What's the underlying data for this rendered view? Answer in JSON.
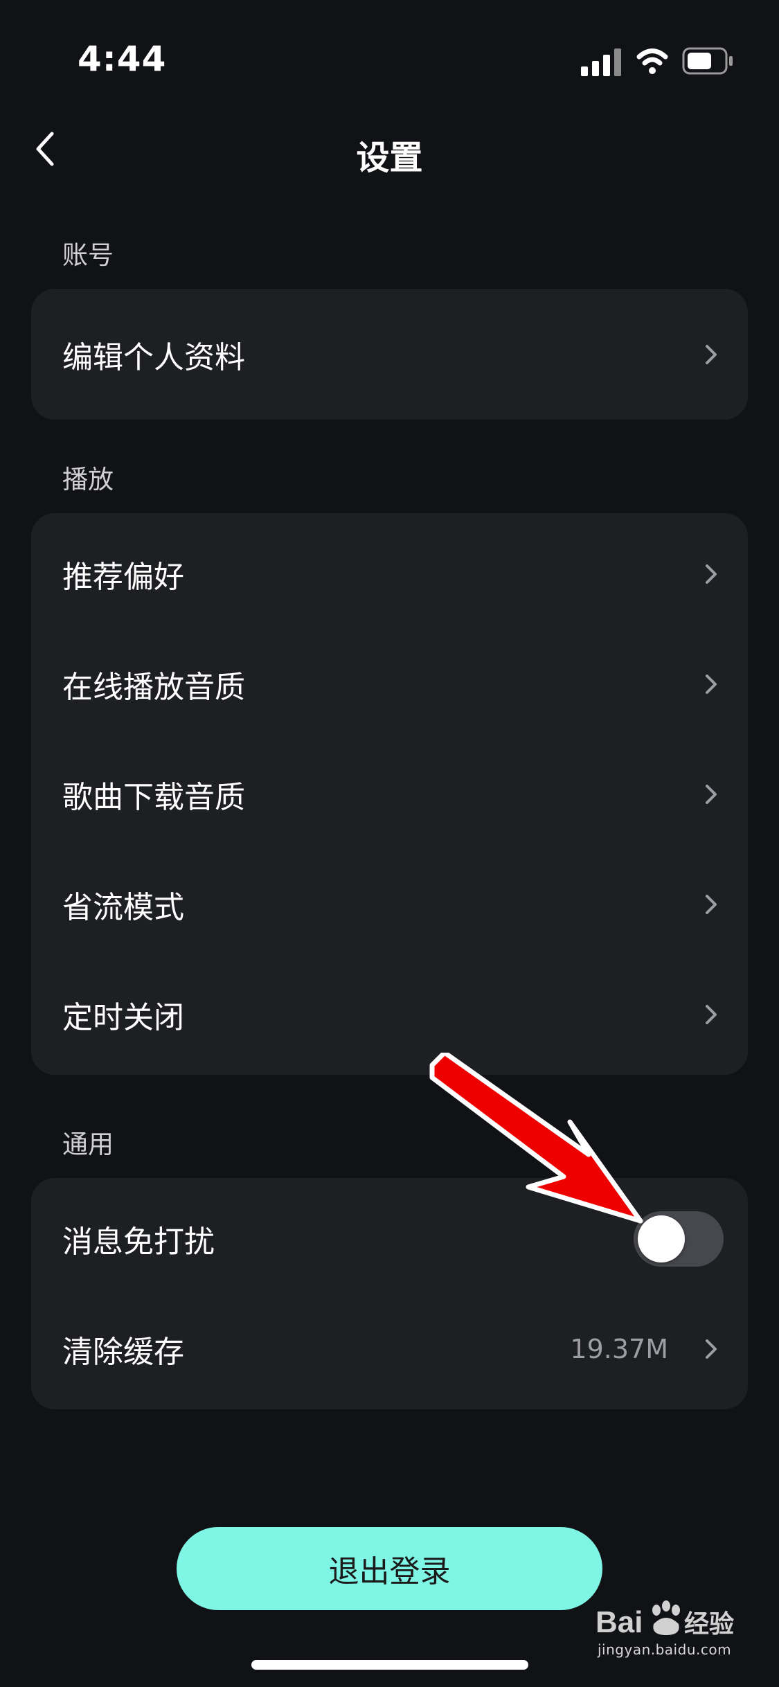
{
  "status_bar": {
    "time": "4:44",
    "icons": [
      "cellular-signal-icon",
      "wifi-icon",
      "battery-icon"
    ]
  },
  "nav": {
    "title": "设置",
    "back_icon": "chevron-left-icon"
  },
  "sections": {
    "account": {
      "header": "账号",
      "items": [
        {
          "label": "编辑个人资料"
        }
      ]
    },
    "playback": {
      "header": "播放",
      "items": [
        {
          "label": "推荐偏好"
        },
        {
          "label": "在线播放音质"
        },
        {
          "label": "歌曲下载音质"
        },
        {
          "label": "省流模式"
        },
        {
          "label": "定时关闭"
        }
      ]
    },
    "general": {
      "header": "通用",
      "items": [
        {
          "label": "消息免打扰",
          "toggle_on": false
        },
        {
          "label": "清除缓存",
          "value": "19.37M"
        }
      ]
    }
  },
  "logout": {
    "label": "退出登录"
  },
  "colors": {
    "background": "#111215",
    "card": "#1e1f23",
    "accent": "#7ff5e5",
    "toggle_off": "#47484d",
    "annotation_arrow": "#ee0000"
  },
  "watermark": {
    "text": "jingyan.baidu.com",
    "logo": "baidu-jingyan-logo"
  }
}
